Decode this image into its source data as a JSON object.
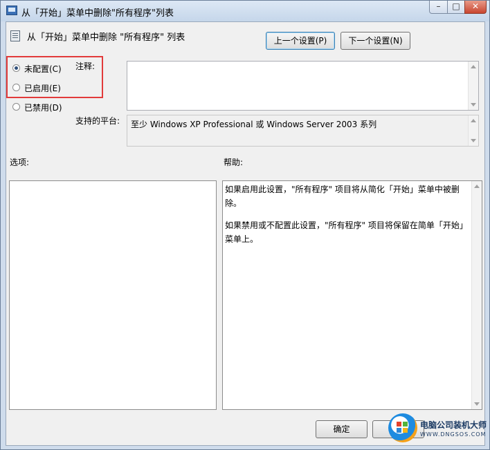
{
  "window": {
    "title": "从「开始」菜单中删除\"所有程序\"列表",
    "buttons": {
      "minimize": "–",
      "maximize": "□",
      "close": "✕"
    }
  },
  "header": {
    "policy_title": "从「开始」菜单中删除 \"所有程序\" 列表",
    "prev_button": "上一个设置(P)",
    "next_button": "下一个设置(N)"
  },
  "state": {
    "options": [
      {
        "label": "未配置(C)",
        "checked": true
      },
      {
        "label": "已启用(E)",
        "checked": false
      },
      {
        "label": "已禁用(D)",
        "checked": false
      }
    ]
  },
  "comment": {
    "label": "注释:",
    "value": ""
  },
  "platform": {
    "label": "支持的平台:",
    "value": "至少 Windows XP Professional 或 Windows Server 2003 系列"
  },
  "options_pane": {
    "label": "选项:"
  },
  "help_pane": {
    "label": "帮助:",
    "paragraphs": [
      "如果启用此设置，\"所有程序\" 项目将从简化「开始」菜单中被删除。",
      "如果禁用或不配置此设置，\"所有程序\" 项目将保留在简单「开始」菜单上。"
    ]
  },
  "footer": {
    "ok_button": "确定"
  },
  "watermark": {
    "name": "电脑公司装机大师",
    "url": "WWW.DNGSOS.COM"
  },
  "colors": {
    "highlight_box": "#e23a3a",
    "title_bar": "#c5d6ea"
  }
}
